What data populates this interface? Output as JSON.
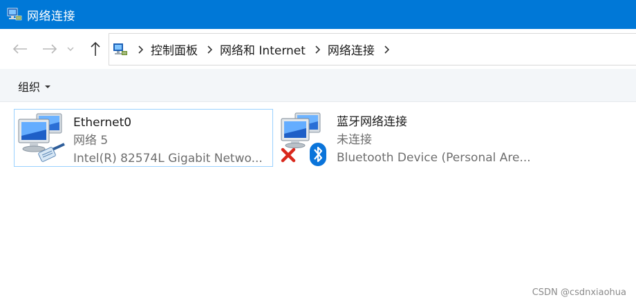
{
  "window": {
    "title": "网络连接"
  },
  "nav": {
    "up_label": "↑"
  },
  "breadcrumb": [
    "控制面板",
    "网络和 Internet",
    "网络连接"
  ],
  "toolbar": {
    "organize_label": "组织"
  },
  "connections": [
    {
      "name": "Ethernet0",
      "status": "网络 5",
      "device": "Intel(R) 82574L Gigabit Netwo...",
      "selected": true,
      "disabled": false
    },
    {
      "name": "蓝牙网络连接",
      "status": "未连接",
      "device": "Bluetooth Device (Personal Are...",
      "selected": false,
      "disabled": true
    }
  ],
  "watermark": "CSDN @csdnxiaohua",
  "colors": {
    "titlebar": "#0078d7",
    "selection_border": "#99d1ff",
    "cmdbar_bg": "#f3f6f9",
    "status_text": "#6d6d6d",
    "error_red": "#d9281c",
    "bluetooth_blue": "#0a74da"
  }
}
